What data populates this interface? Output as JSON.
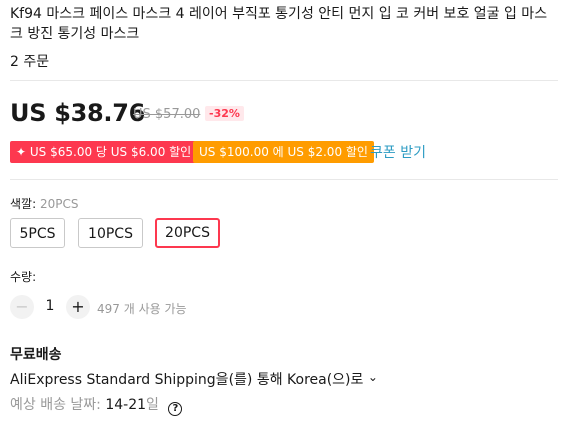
{
  "product": {
    "title": "Kf94 마스크 페이스 마스크 4 레이어 부직포 통기성 안티 먼지 입 코 커버 보호 얼굴 입 마스크 방진 통기성 마스크",
    "orders": "2 주문"
  },
  "pricing": {
    "current": "US $38.76",
    "original": "US $57.00",
    "discount": "-32%"
  },
  "coupons": [
    {
      "text": "US $65.00 당 US $6.00 할인",
      "icon": "✦",
      "color": "#fd384f"
    },
    {
      "text": "US $100.00 에 US $2.00 할인",
      "color": "#ff9c00"
    }
  ],
  "coupon_link": "쿠폰 받기",
  "color_option": {
    "label": "색깔:",
    "selected": "20PCS",
    "options": [
      "5PCS",
      "10PCS",
      "20PCS"
    ]
  },
  "quantity": {
    "label": "수량:",
    "minus": "−",
    "value": "1",
    "plus": "+",
    "available": "497 개 사용 가능"
  },
  "shipping": {
    "heading": "무료배송",
    "method": "AliExpress Standard Shipping을(를) 통해 Korea(으)로",
    "chevron": "⌄",
    "eta_label": "예상 배송 날짜:",
    "eta_value": "14-21",
    "eta_unit": "일",
    "help": "?"
  }
}
